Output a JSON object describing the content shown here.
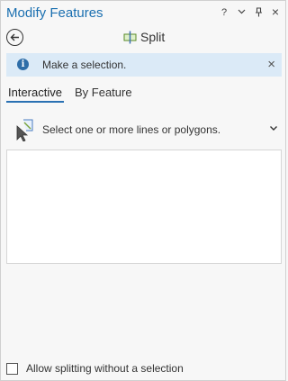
{
  "window": {
    "title": "Modify Features",
    "controls": {
      "help": "?",
      "menu_icon": "chevron-down-icon",
      "pin_icon": "pin-icon",
      "close": "×"
    }
  },
  "toolbar": {
    "back_icon": "back-arrow-icon",
    "tool_icon": "split-icon",
    "tool_title": "Split"
  },
  "banner": {
    "icon": "info-icon",
    "icon_glyph": "i",
    "message": "Make a selection.",
    "close": "×",
    "color": "#dbeaf7"
  },
  "tabs": [
    {
      "label": "Interactive",
      "active": true
    },
    {
      "label": "By Feature",
      "active": false
    }
  ],
  "selection_method": {
    "icon": "select-lines-polygons-icon",
    "text": "Select one or more lines or polygons.",
    "dropdown_icon": "chevron-down-icon"
  },
  "selection_list": {
    "items": []
  },
  "options": {
    "allow_without_selection": {
      "label": "Allow splitting without a selection",
      "checked": false
    }
  },
  "colors": {
    "accent": "#1a6fb0",
    "tab_underline": "#2a71b3",
    "background": "#f7f7f7"
  }
}
